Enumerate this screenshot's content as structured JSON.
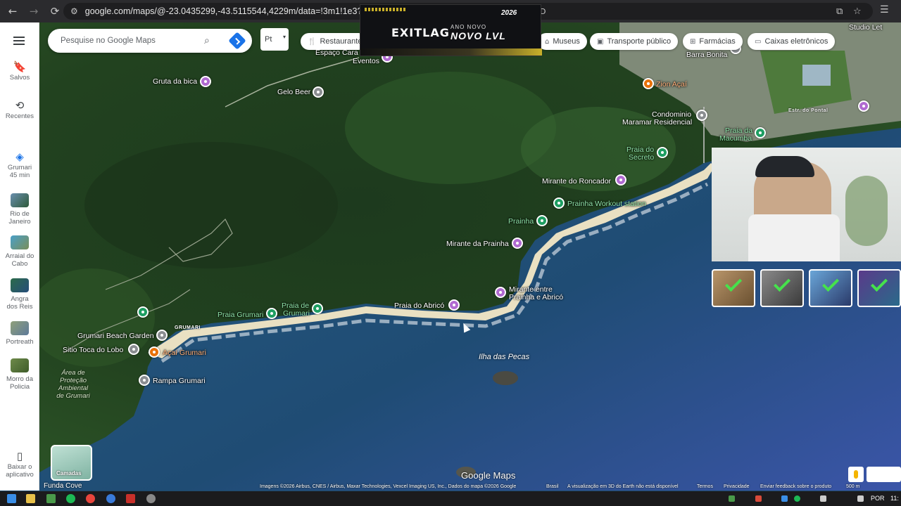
{
  "browser": {
    "url": "google.com/maps/@-23.0435299,-43.5115544,4229m/data=!3m1!1e3?entry=ttu&",
    "url_suffix": "3D",
    "back": "←",
    "forward": "→",
    "reload": "⟳"
  },
  "rail": {
    "saved": "Salvos",
    "recent": "Recentes",
    "grumari_line1": "Grumari",
    "grumari_line2": "45 min",
    "rio_line1": "Rio de",
    "rio_line2": "Janeiro",
    "arraial_line1": "Arraial do",
    "arraial_line2": "Cabo",
    "angra_line1": "Angra",
    "angra_line2": "dos Reis",
    "portreath": "Portreath",
    "morro_line1": "Morro da",
    "morro_line2": "Policia",
    "download_line1": "Baixar o",
    "download_line2": "aplicativo"
  },
  "search": {
    "placeholder": "Pesquise no Google Maps",
    "lang": "Pt"
  },
  "chips": {
    "restaurants": "Restaurante",
    "museums": "Museus",
    "transit": "Transporte público",
    "pharmacies": "Farmácias",
    "atms": "Caixas eletrônicos"
  },
  "ad": {
    "brand": "EXITLAG",
    "small": "ANO NOVO",
    "big": "NOVO LVL",
    "year": "2026"
  },
  "places": {
    "espaco": "Espaço Cara",
    "eventos": "Eventos",
    "gruta": "Gruta da bica",
    "gelo": "Gelo Beer",
    "zion": "Zion Açaí",
    "barra_bonita": "Barra Bonita",
    "studio": "Studio Let",
    "condominio_line1": "Condominio",
    "condominio_line2": "Maramar Residencial",
    "macumba_line1": "Praia da",
    "macumba_line2": "Macumba",
    "secreto_line1": "Praia do",
    "secreto_line2": "Secreto",
    "roncador": "Mirante do Roncador",
    "workout": "Prainha Workout station",
    "prainha": "Prainha",
    "mirante_prainha": "Mirante da Prainha",
    "mirante_entre_line1": "Mirante entre",
    "mirante_entre_line2": "Prainha e Abricó",
    "abrico": "Praia do Abricó",
    "praia_de_grumari_line1": "Praia de",
    "praia_de_grumari_line2": "Grumari",
    "praia_grumari": "Praia Grumari",
    "grumari_road": "GRUMARI",
    "beach_garden": "Grumari Beach Garden",
    "sitio": "Sitio Toca do Lobo",
    "acai": "Açaí Grumari",
    "rampa": "Rampa Grumari",
    "area_line1": "Área de",
    "area_line2": "Proteção",
    "area_line3": "Ambiental",
    "area_line4": "de Grumari",
    "island": "Ilha das Pecas",
    "cove": "Funda Cove",
    "road_pontal": "Estr. do Pontal"
  },
  "map_controls": {
    "layers": "Camadas",
    "logo": "Google Maps"
  },
  "attribution": {
    "imagery": "Imagens ©2026 Airbus, CNES / Airbus, Maxar Technologies, Vexcel Imaging US, Inc., Dados do mapa ©2026 Google",
    "country": "Brasil",
    "note3d": "A visualização em 3D do Earth não está disponível",
    "terms": "Termos",
    "privacy": "Privacidade",
    "feedback": "Enviar feedback sobre o produto",
    "scale": "500 m"
  },
  "taskbar": {
    "lang": "POR",
    "time": "11:"
  },
  "colors": {
    "accent": "#1a73e8",
    "poi_purple": "#b06ad1",
    "poi_green": "#1e9e62",
    "poi_orange": "#e8710a"
  }
}
